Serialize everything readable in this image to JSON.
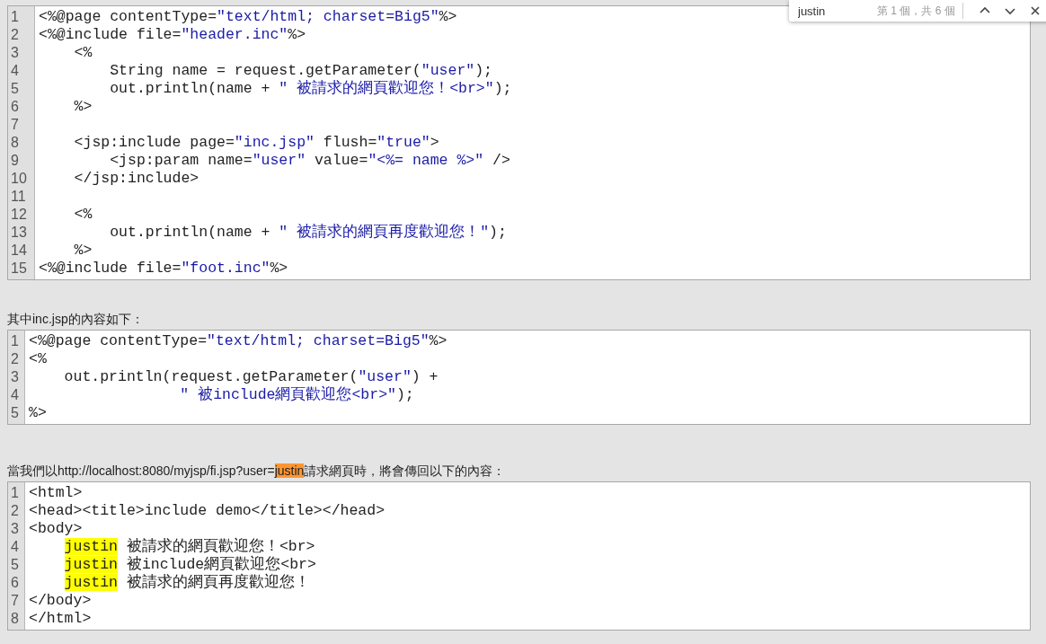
{
  "find_bar": {
    "query": "justin",
    "match_count": "第 1 個，共 6 個"
  },
  "sections": [
    {
      "code": [
        {
          "number": "1",
          "segments": [
            {
              "text": "<%@page contentType=",
              "kind": "plain"
            },
            {
              "text": "\"text/html; charset=Big5\"",
              "kind": "string"
            },
            {
              "text": "%>",
              "kind": "plain"
            }
          ]
        },
        {
          "number": "2",
          "segments": [
            {
              "text": "<%@include file=",
              "kind": "plain"
            },
            {
              "text": "\"header.inc\"",
              "kind": "string"
            },
            {
              "text": "%>",
              "kind": "plain"
            }
          ]
        },
        {
          "number": "3",
          "segments": [
            {
              "text": "    <%",
              "kind": "plain"
            }
          ]
        },
        {
          "number": "4",
          "segments": [
            {
              "text": "        String name = request.getParameter(",
              "kind": "plain"
            },
            {
              "text": "\"user\"",
              "kind": "string"
            },
            {
              "text": ");",
              "kind": "plain"
            }
          ]
        },
        {
          "number": "5",
          "segments": [
            {
              "text": "        out.println(name + ",
              "kind": "plain"
            },
            {
              "text": "\" 被請求的網頁歡迎您！<br>\"",
              "kind": "string"
            },
            {
              "text": ");",
              "kind": "plain"
            }
          ]
        },
        {
          "number": "6",
          "segments": [
            {
              "text": "    %>",
              "kind": "plain"
            }
          ]
        },
        {
          "number": "7"
        },
        {
          "number": "8",
          "segments": [
            {
              "text": "    <jsp:include page=",
              "kind": "plain"
            },
            {
              "text": "\"inc.jsp\"",
              "kind": "string"
            },
            {
              "text": " flush=",
              "kind": "plain"
            },
            {
              "text": "\"true\"",
              "kind": "string"
            },
            {
              "text": ">",
              "kind": "plain"
            }
          ]
        },
        {
          "number": "9",
          "segments": [
            {
              "text": "        <jsp:param name=",
              "kind": "plain"
            },
            {
              "text": "\"user\"",
              "kind": "string"
            },
            {
              "text": " value=",
              "kind": "plain"
            },
            {
              "text": "\"<%= name %>\"",
              "kind": "string"
            },
            {
              "text": " />",
              "kind": "plain"
            }
          ]
        },
        {
          "number": "10",
          "segments": [
            {
              "text": "    </jsp:include>",
              "kind": "plain"
            }
          ]
        },
        {
          "number": "11"
        },
        {
          "number": "12",
          "segments": [
            {
              "text": "    <%",
              "kind": "plain"
            }
          ]
        },
        {
          "number": "13",
          "segments": [
            {
              "text": "        out.println(name + ",
              "kind": "plain"
            },
            {
              "text": "\" 被請求的網頁再度歡迎您！\"",
              "kind": "string"
            },
            {
              "text": ");",
              "kind": "plain"
            }
          ]
        },
        {
          "number": "14",
          "segments": [
            {
              "text": "    %>",
              "kind": "plain"
            }
          ]
        },
        {
          "number": "15",
          "segments": [
            {
              "text": "<%@include file=",
              "kind": "plain"
            },
            {
              "text": "\"foot.inc\"",
              "kind": "string"
            },
            {
              "text": "%>",
              "kind": "plain"
            }
          ]
        }
      ]
    },
    {
      "caption": [
        {
          "text": "其中inc.jsp的內容如下：",
          "kind": "plain"
        }
      ],
      "code": [
        {
          "number": "1",
          "segments": [
            {
              "text": "<%@page contentType=",
              "kind": "plain"
            },
            {
              "text": "\"text/html; charset=Big5\"",
              "kind": "string"
            },
            {
              "text": "%>",
              "kind": "plain"
            }
          ]
        },
        {
          "number": "2",
          "segments": [
            {
              "text": "<%",
              "kind": "plain"
            }
          ]
        },
        {
          "number": "3",
          "segments": [
            {
              "text": "    out.println(request.getParameter(",
              "kind": "plain"
            },
            {
              "text": "\"user\"",
              "kind": "string"
            },
            {
              "text": ") +",
              "kind": "plain"
            }
          ]
        },
        {
          "number": "4",
          "segments": [
            {
              "text": "                 \" 被include網頁歡迎您<br>\"",
              "kind": "string"
            },
            {
              "text": ");",
              "kind": "plain"
            }
          ]
        },
        {
          "number": "5",
          "segments": [
            {
              "text": "%>",
              "kind": "plain"
            }
          ]
        }
      ]
    },
    {
      "caption": [
        {
          "text": "當我們以http://localhost:8080/myjsp/fi.jsp?user=",
          "kind": "plain"
        },
        {
          "text": "justin",
          "kind": "current_match"
        },
        {
          "text": "請求網頁時，將會傳回以下的內容：",
          "kind": "plain"
        }
      ],
      "code": [
        {
          "number": "1",
          "segments": [
            {
              "text": "<html>",
              "kind": "plain"
            }
          ]
        },
        {
          "number": "2",
          "segments": [
            {
              "text": "<head><title>include demo</title></head>",
              "kind": "plain"
            }
          ]
        },
        {
          "number": "3",
          "segments": [
            {
              "text": "<body>",
              "kind": "plain"
            }
          ]
        },
        {
          "number": "4",
          "indented": true,
          "segments": [
            {
              "text": "justin",
              "kind": "match"
            },
            {
              "text": " 被請求的網頁歡迎您！<br>",
              "kind": "plain"
            }
          ]
        },
        {
          "number": "5",
          "indented": true,
          "segments": [
            {
              "text": "justin",
              "kind": "match"
            },
            {
              "text": " 被include網頁歡迎您<br>",
              "kind": "plain"
            }
          ]
        },
        {
          "number": "6",
          "indented": true,
          "segments": [
            {
              "text": "justin",
              "kind": "match"
            },
            {
              "text": " 被請求的網頁再度歡迎您！",
              "kind": "plain"
            }
          ]
        },
        {
          "number": "7",
          "segments": [
            {
              "text": "</body>",
              "kind": "plain"
            }
          ]
        },
        {
          "number": "8",
          "segments": [
            {
              "text": "</html>",
              "kind": "plain"
            }
          ]
        }
      ]
    }
  ]
}
